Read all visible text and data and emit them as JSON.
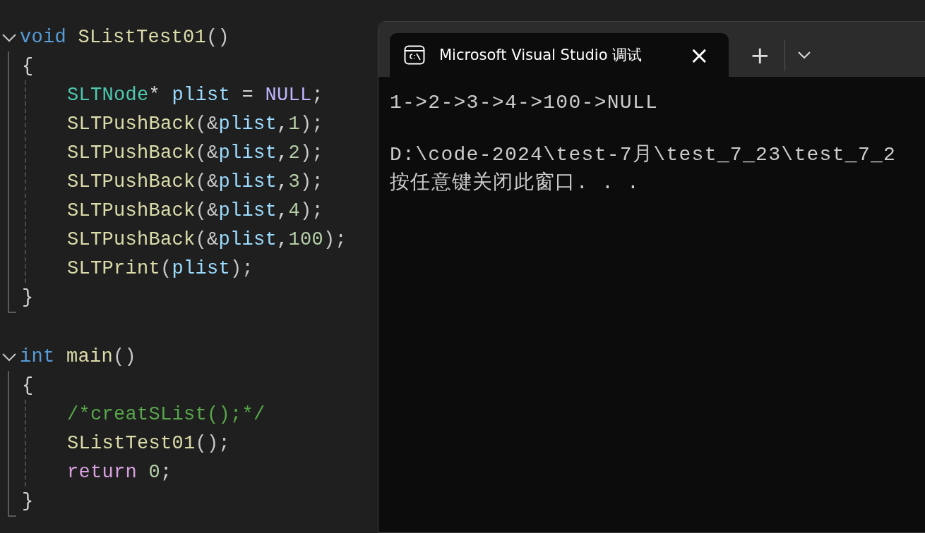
{
  "editor": {
    "functions": [
      {
        "expanded": true,
        "header": [
          {
            "t": "void ",
            "kind": "keyword"
          },
          {
            "t": "SListTest01",
            "kind": "function"
          },
          {
            "t": "()",
            "kind": "paren"
          }
        ],
        "open": "{",
        "close": "}",
        "statements": [
          [
            {
              "t": "SLTNode",
              "kind": "type"
            },
            {
              "t": "* ",
              "kind": "punct"
            },
            {
              "t": "plist",
              "kind": "variable"
            },
            {
              "t": " = ",
              "kind": "punct"
            },
            {
              "t": "NULL",
              "kind": "macro"
            },
            {
              "t": ";",
              "kind": "punct"
            }
          ],
          [
            {
              "t": "SLTPushBack",
              "kind": "function"
            },
            {
              "t": "(&",
              "kind": "paren"
            },
            {
              "t": "plist",
              "kind": "variable"
            },
            {
              "t": ",",
              "kind": "punct"
            },
            {
              "t": "1",
              "kind": "number"
            },
            {
              "t": ");",
              "kind": "paren"
            }
          ],
          [
            {
              "t": "SLTPushBack",
              "kind": "function"
            },
            {
              "t": "(&",
              "kind": "paren"
            },
            {
              "t": "plist",
              "kind": "variable"
            },
            {
              "t": ",",
              "kind": "punct"
            },
            {
              "t": "2",
              "kind": "number"
            },
            {
              "t": ");",
              "kind": "paren"
            }
          ],
          [
            {
              "t": "SLTPushBack",
              "kind": "function"
            },
            {
              "t": "(&",
              "kind": "paren"
            },
            {
              "t": "plist",
              "kind": "variable"
            },
            {
              "t": ",",
              "kind": "punct"
            },
            {
              "t": "3",
              "kind": "number"
            },
            {
              "t": ");",
              "kind": "paren"
            }
          ],
          [
            {
              "t": "SLTPushBack",
              "kind": "function"
            },
            {
              "t": "(&",
              "kind": "paren"
            },
            {
              "t": "plist",
              "kind": "variable"
            },
            {
              "t": ",",
              "kind": "punct"
            },
            {
              "t": "4",
              "kind": "number"
            },
            {
              "t": ");",
              "kind": "paren"
            }
          ],
          [
            {
              "t": "SLTPushBack",
              "kind": "function"
            },
            {
              "t": "(&",
              "kind": "paren"
            },
            {
              "t": "plist",
              "kind": "variable"
            },
            {
              "t": ",",
              "kind": "punct"
            },
            {
              "t": "100",
              "kind": "number"
            },
            {
              "t": ");",
              "kind": "paren"
            }
          ],
          [
            {
              "t": "SLTPrint",
              "kind": "function"
            },
            {
              "t": "(",
              "kind": "paren"
            },
            {
              "t": "plist",
              "kind": "variable"
            },
            {
              "t": ");",
              "kind": "paren"
            }
          ]
        ]
      },
      {
        "expanded": true,
        "header": [
          {
            "t": "int ",
            "kind": "keyword"
          },
          {
            "t": "main",
            "kind": "function"
          },
          {
            "t": "()",
            "kind": "paren"
          }
        ],
        "open": "{",
        "close": "}",
        "statements": [
          [
            {
              "t": "/*creatSList();*/",
              "kind": "comment"
            }
          ],
          [
            {
              "t": "SListTest01",
              "kind": "function"
            },
            {
              "t": "();",
              "kind": "paren"
            }
          ],
          [
            {
              "t": "return ",
              "kind": "control"
            },
            {
              "t": "0",
              "kind": "number"
            },
            {
              "t": ";",
              "kind": "punct"
            }
          ]
        ]
      }
    ]
  },
  "terminal": {
    "tab": {
      "title": "Microsoft Visual Studio 调试",
      "close": "×",
      "selected": true
    },
    "new_tab": "+",
    "output": [
      [
        "1->2->3->4->100->NULL"
      ],
      [
        "D:\\code-2024\\test-7月\\test_7_23\\test_7_2",
        "按任意键关闭此窗口. . ."
      ]
    ]
  }
}
